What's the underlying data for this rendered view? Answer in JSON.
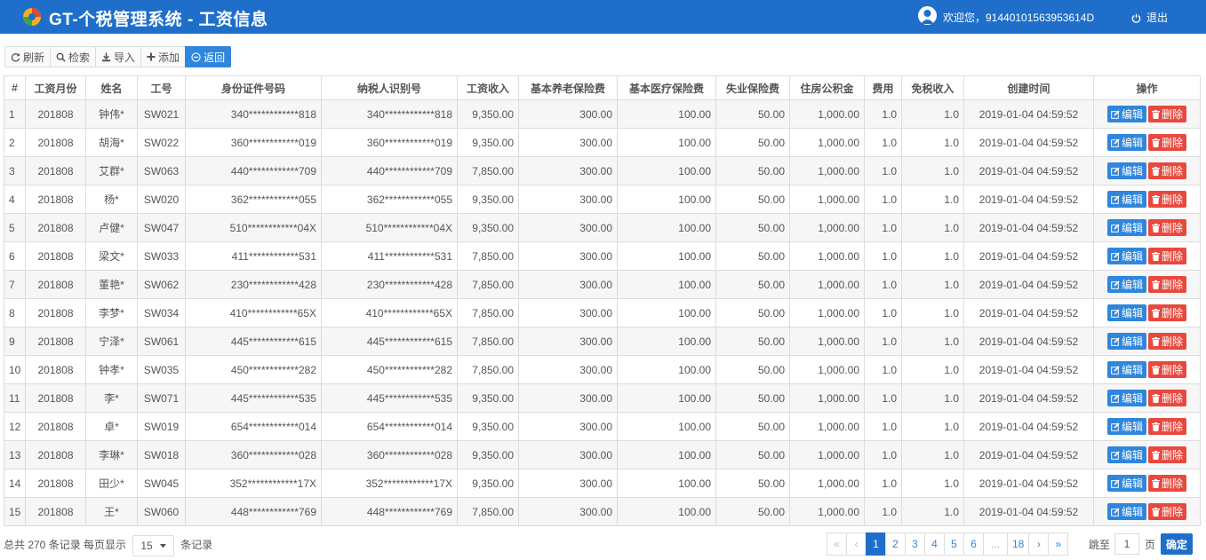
{
  "header": {
    "title": "GT-个税管理系统 - 工资信息",
    "welcome": "欢迎您，91440101563953614D",
    "logout": "退出"
  },
  "toolbar": {
    "refresh": "刷新",
    "search": "检索",
    "import": "导入",
    "add": "添加",
    "back": "返回"
  },
  "table": {
    "columns": [
      "#",
      "工资月份",
      "姓名",
      "工号",
      "身份证件号码",
      "纳税人识别号",
      "工资收入",
      "基本养老保险费",
      "基本医疗保险费",
      "失业保险费",
      "住房公积金",
      "费用",
      "免税收入",
      "创建时间",
      "操作"
    ],
    "edit_label": "编辑",
    "delete_label": "删除",
    "rows": [
      [
        "1",
        "201808",
        "钟伟*",
        "SW021",
        "340************818",
        "340************818",
        "9,350.00",
        "300.00",
        "100.00",
        "50.00",
        "1,000.00",
        "1.0",
        "1.0",
        "2019-01-04 04:59:52"
      ],
      [
        "2",
        "201808",
        "胡海*",
        "SW022",
        "360************019",
        "360************019",
        "9,350.00",
        "300.00",
        "100.00",
        "50.00",
        "1,000.00",
        "1.0",
        "1.0",
        "2019-01-04 04:59:52"
      ],
      [
        "3",
        "201808",
        "艾群*",
        "SW063",
        "440************709",
        "440************709",
        "7,850.00",
        "300.00",
        "100.00",
        "50.00",
        "1,000.00",
        "1.0",
        "1.0",
        "2019-01-04 04:59:52"
      ],
      [
        "4",
        "201808",
        "杨*",
        "SW020",
        "362************055",
        "362************055",
        "9,350.00",
        "300.00",
        "100.00",
        "50.00",
        "1,000.00",
        "1.0",
        "1.0",
        "2019-01-04 04:59:52"
      ],
      [
        "5",
        "201808",
        "卢健*",
        "SW047",
        "510************04X",
        "510************04X",
        "9,350.00",
        "300.00",
        "100.00",
        "50.00",
        "1,000.00",
        "1.0",
        "1.0",
        "2019-01-04 04:59:52"
      ],
      [
        "6",
        "201808",
        "梁文*",
        "SW033",
        "411************531",
        "411************531",
        "7,850.00",
        "300.00",
        "100.00",
        "50.00",
        "1,000.00",
        "1.0",
        "1.0",
        "2019-01-04 04:59:52"
      ],
      [
        "7",
        "201808",
        "董艳*",
        "SW062",
        "230************428",
        "230************428",
        "7,850.00",
        "300.00",
        "100.00",
        "50.00",
        "1,000.00",
        "1.0",
        "1.0",
        "2019-01-04 04:59:52"
      ],
      [
        "8",
        "201808",
        "李梦*",
        "SW034",
        "410************65X",
        "410************65X",
        "7,850.00",
        "300.00",
        "100.00",
        "50.00",
        "1,000.00",
        "1.0",
        "1.0",
        "2019-01-04 04:59:52"
      ],
      [
        "9",
        "201808",
        "宁泽*",
        "SW061",
        "445************615",
        "445************615",
        "7,850.00",
        "300.00",
        "100.00",
        "50.00",
        "1,000.00",
        "1.0",
        "1.0",
        "2019-01-04 04:59:52"
      ],
      [
        "10",
        "201808",
        "钟孝*",
        "SW035",
        "450************282",
        "450************282",
        "7,850.00",
        "300.00",
        "100.00",
        "50.00",
        "1,000.00",
        "1.0",
        "1.0",
        "2019-01-04 04:59:52"
      ],
      [
        "11",
        "201808",
        "李*",
        "SW071",
        "445************535",
        "445************535",
        "9,350.00",
        "300.00",
        "100.00",
        "50.00",
        "1,000.00",
        "1.0",
        "1.0",
        "2019-01-04 04:59:52"
      ],
      [
        "12",
        "201808",
        "卓*",
        "SW019",
        "654************014",
        "654************014",
        "9,350.00",
        "300.00",
        "100.00",
        "50.00",
        "1,000.00",
        "1.0",
        "1.0",
        "2019-01-04 04:59:52"
      ],
      [
        "13",
        "201808",
        "李琳*",
        "SW018",
        "360************028",
        "360************028",
        "9,350.00",
        "300.00",
        "100.00",
        "50.00",
        "1,000.00",
        "1.0",
        "1.0",
        "2019-01-04 04:59:52"
      ],
      [
        "14",
        "201808",
        "田少*",
        "SW045",
        "352************17X",
        "352************17X",
        "9,350.00",
        "300.00",
        "100.00",
        "50.00",
        "1,000.00",
        "1.0",
        "1.0",
        "2019-01-04 04:59:52"
      ],
      [
        "15",
        "201808",
        "王*",
        "SW060",
        "448************769",
        "448************769",
        "7,850.00",
        "300.00",
        "100.00",
        "50.00",
        "1,000.00",
        "1.0",
        "1.0",
        "2019-01-04 04:59:52"
      ]
    ]
  },
  "footer": {
    "total_text": "总共 270 条记录 每页显示",
    "page_size": "15",
    "suffix_text": "条记录",
    "pages": [
      {
        "label": "«",
        "state": "disabled"
      },
      {
        "label": "‹",
        "state": "disabled"
      },
      {
        "label": "1",
        "state": "active"
      },
      {
        "label": "2",
        "state": "normal"
      },
      {
        "label": "3",
        "state": "normal"
      },
      {
        "label": "4",
        "state": "normal"
      },
      {
        "label": "5",
        "state": "normal"
      },
      {
        "label": "6",
        "state": "normal"
      },
      {
        "label": "...",
        "state": "dots"
      },
      {
        "label": "18",
        "state": "normal"
      },
      {
        "label": "›",
        "state": "normal"
      },
      {
        "label": "»",
        "state": "normal"
      }
    ],
    "jump_label": "跳至",
    "jump_value": "1",
    "page_unit": "页",
    "confirm": "确定"
  },
  "colors": {
    "header_bg": "#1f6fca",
    "primary": "#2f86dc",
    "danger": "#e8493e"
  }
}
